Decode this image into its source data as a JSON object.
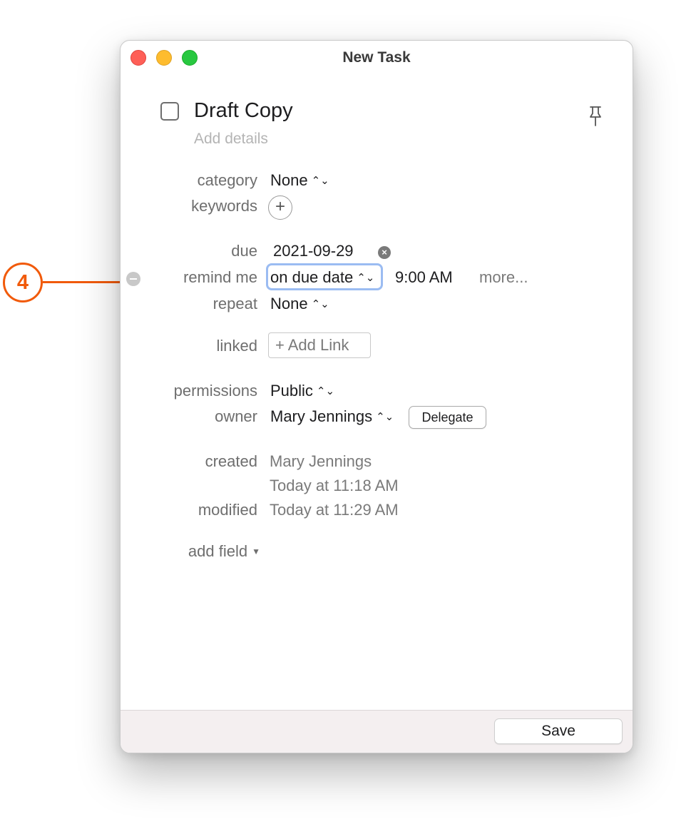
{
  "window": {
    "title": "New Task"
  },
  "task": {
    "title": "Draft Copy",
    "details_placeholder": "Add details"
  },
  "fields": {
    "category": {
      "label": "category",
      "value": "None"
    },
    "keywords": {
      "label": "keywords"
    },
    "due": {
      "label": "due",
      "value": "2021-09-29"
    },
    "remind_me": {
      "label": "remind me",
      "value": "on due date",
      "time": "9:00 AM",
      "more": "more..."
    },
    "repeat": {
      "label": "repeat",
      "value": "None"
    },
    "linked": {
      "label": "linked",
      "button": "+ Add Link"
    },
    "permissions": {
      "label": "permissions",
      "value": "Public"
    },
    "owner": {
      "label": "owner",
      "value": "Mary Jennings",
      "delegate": "Delegate"
    },
    "created": {
      "label": "created",
      "by": "Mary Jennings",
      "when": "Today at 11:18 AM"
    },
    "modified": {
      "label": "modified",
      "when": "Today at 11:29 AM"
    },
    "add_field": "add field"
  },
  "footer": {
    "save_label": "Save"
  },
  "callout": {
    "number": "4",
    "color": "#f15a0a"
  },
  "colors": {
    "close": "#fe5f57",
    "minimize": "#febc2e",
    "maximize": "#28c840",
    "focus_ring": "#9bbcf2"
  },
  "icons": {
    "pin": "pushpin-icon",
    "plus": "plus-circle-icon",
    "clear": "clear-x-icon",
    "remove": "minus-circle-icon",
    "chevron": "up-down-chevron-icon",
    "caret": "caret-down-icon"
  }
}
